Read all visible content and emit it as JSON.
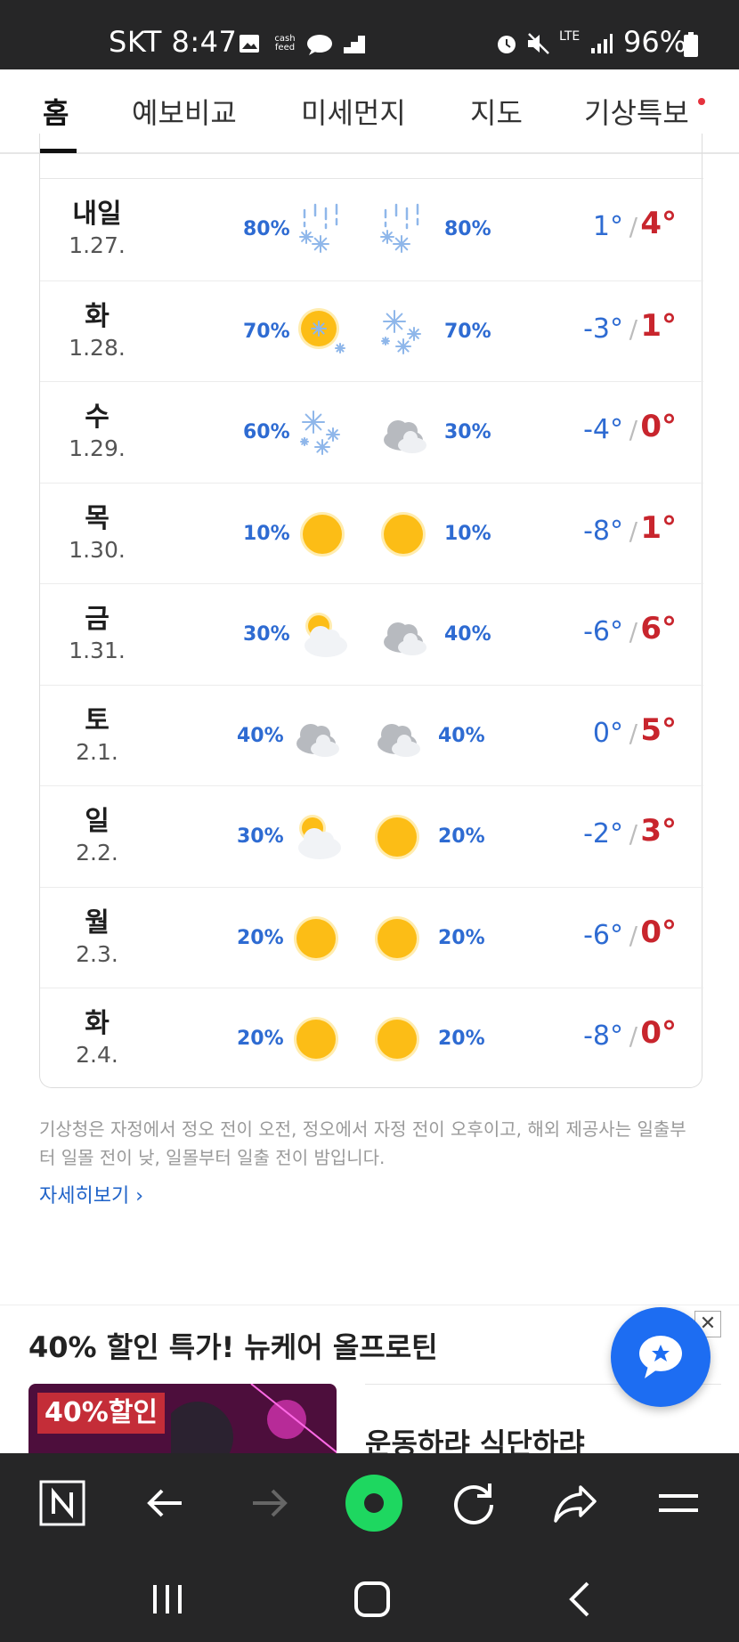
{
  "status_bar": {
    "carrier_time": "SKT 8:47",
    "battery": "96%",
    "network": "LTE",
    "cashfeed_label": "cash feed",
    "left_icons": [
      "image-icon",
      "cashfeed-icon",
      "chat-bubble-icon",
      "stairs-icon"
    ],
    "right_icons": [
      "alarm-icon",
      "mute-icon",
      "lte-icon",
      "signal-icon",
      "battery-icon"
    ]
  },
  "tabs": [
    {
      "label": "홈",
      "active": true
    },
    {
      "label": "예보비교"
    },
    {
      "label": "미세먼지"
    },
    {
      "label": "지도"
    },
    {
      "label": "기상특보",
      "has_dot": true
    }
  ],
  "forecast": [
    {
      "day": "내일",
      "date": "1.27.",
      "am_pct": "80%",
      "am_icon": "snow-rain-icon",
      "pm_icon": "snow-rain-icon",
      "pm_pct": "80%",
      "low": "1°",
      "high": "4°"
    },
    {
      "day": "화",
      "date": "1.28.",
      "am_pct": "70%",
      "am_icon": "sun-snow-icon",
      "pm_icon": "snow-icon",
      "pm_pct": "70%",
      "low": "-3°",
      "high": "1°"
    },
    {
      "day": "수",
      "date": "1.29.",
      "am_pct": "60%",
      "am_icon": "snow-icon",
      "pm_icon": "cloudy-icon",
      "pm_pct": "30%",
      "low": "-4°",
      "high": "0°"
    },
    {
      "day": "목",
      "date": "1.30.",
      "am_pct": "10%",
      "am_icon": "sun-icon",
      "pm_icon": "sun-icon",
      "pm_pct": "10%",
      "low": "-8°",
      "high": "1°"
    },
    {
      "day": "금",
      "date": "1.31.",
      "am_pct": "30%",
      "am_icon": "partly-cloudy-icon",
      "pm_icon": "cloudy-icon",
      "pm_pct": "40%",
      "low": "-6°",
      "high": "6°"
    },
    {
      "day": "토",
      "date": "2.1.",
      "am_pct": "40%",
      "am_icon": "cloudy-icon",
      "pm_icon": "cloudy-icon",
      "pm_pct": "40%",
      "low": "0°",
      "high": "5°"
    },
    {
      "day": "일",
      "date": "2.2.",
      "am_pct": "30%",
      "am_icon": "partly-cloudy-icon",
      "pm_icon": "sun-icon",
      "pm_pct": "20%",
      "low": "-2°",
      "high": "3°"
    },
    {
      "day": "월",
      "date": "2.3.",
      "am_pct": "20%",
      "am_icon": "sun-icon",
      "pm_icon": "sun-icon",
      "pm_pct": "20%",
      "low": "-6°",
      "high": "0°"
    },
    {
      "day": "화",
      "date": "2.4.",
      "am_pct": "20%",
      "am_icon": "sun-icon",
      "pm_icon": "sun-icon",
      "pm_pct": "20%",
      "low": "-8°",
      "high": "0°"
    }
  ],
  "note": "기상청은 자정에서 정오 전이 오전, 정오에서 자정 전이 오후이고, 해외 제공사는 일출부터 일몰 전이 낮, 일몰부터 일출 전이 밤입니다.",
  "more_link": "자세히보기",
  "ad": {
    "title": "40% 할인 특가! 뉴케어 올프로틴",
    "badge": "40%할인",
    "text": "운동하랴 식단하랴",
    "close": "✕"
  },
  "toolbar": [
    "naver-home-icon",
    "back-icon",
    "forward-icon",
    "green-dot-icon",
    "reload-icon",
    "share-icon",
    "menu-icon"
  ],
  "navbar": [
    "recents-icon",
    "home-icon",
    "back-nav-icon"
  ],
  "colors": {
    "low": "#2e6bd2",
    "high": "#c8252d",
    "pct": "#2e6bd2",
    "fab": "#1d6df2",
    "bars": "#262627"
  }
}
